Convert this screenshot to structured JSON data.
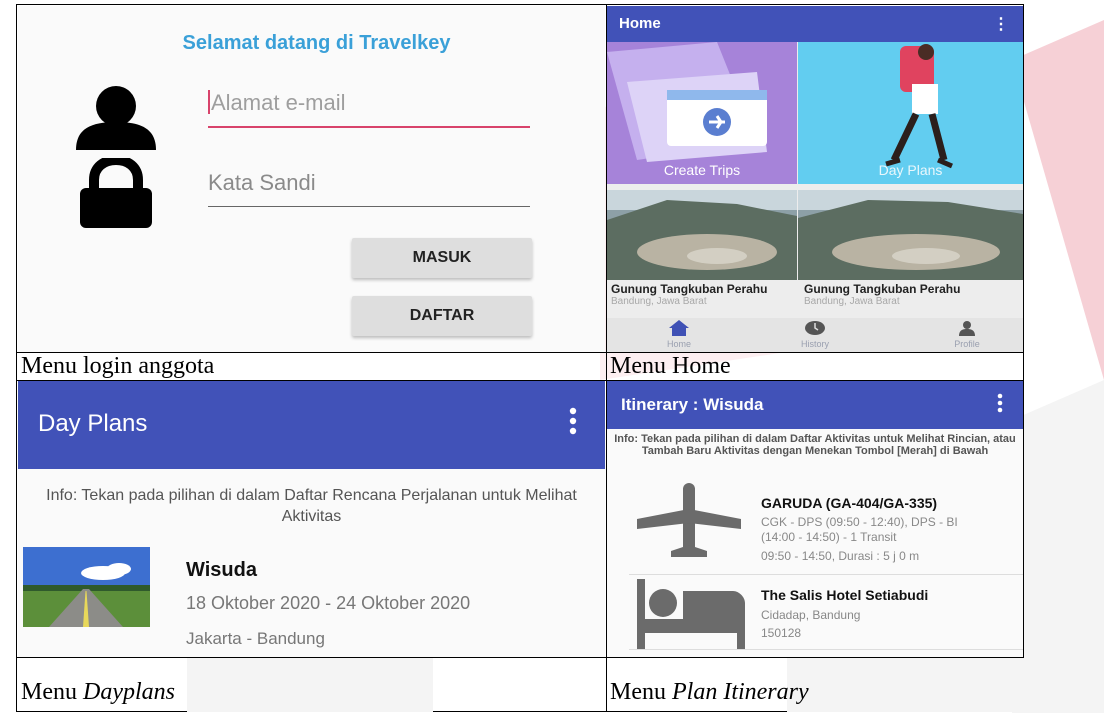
{
  "colors": {
    "app_bar": "#4152b8",
    "welcome_text": "#3aa0d8",
    "input_accent": "#d8436b",
    "button_bg": "#dedede",
    "background_shape": "#f6d7dc"
  },
  "login": {
    "title": "Selamat datang di Travelkey",
    "user_icon": "person-icon",
    "lock_icon": "lock-icon",
    "email_placeholder": "Alamat e-mail",
    "password_placeholder": "Kata Sandi",
    "masuk_label": "MASUK",
    "daftar_label": "DAFTAR",
    "caption": "Menu login anggota"
  },
  "home": {
    "title": "Home",
    "menu_icon": "more-vert-icon",
    "tiles": [
      {
        "label": "Create Trips",
        "icon": "travel-documents-illustration"
      },
      {
        "label": "Day Plans",
        "icon": "walking-traveler-illustration"
      }
    ],
    "cards": [
      {
        "title": "Gunung Tangkuban Perahu",
        "subtitle": "Bandung, Jawa Barat"
      },
      {
        "title": "Gunung Tangkuban Perahu",
        "subtitle": "Bandung, Jawa Barat"
      }
    ],
    "nav": [
      {
        "label": "Home",
        "icon": "home-icon"
      },
      {
        "label": "History",
        "icon": "history-icon"
      },
      {
        "label": "Profile",
        "icon": "person-icon"
      }
    ],
    "caption": "Menu Home"
  },
  "dayplans": {
    "title": "Day Plans",
    "info": "Info: Tekan pada pilihan di dalam Daftar Rencana Perjalanan untuk Melihat Aktivitas",
    "plan": {
      "name": "Wisuda",
      "dates": "18 Oktober 2020 - 24 Oktober 2020",
      "location": "Jakarta - Bandung"
    },
    "caption_prefix": "Menu ",
    "caption_italic": "Dayplans"
  },
  "itinerary": {
    "title": "Itinerary : Wisuda",
    "info": "Info: Tekan pada pilihan di dalam Daftar Aktivitas untuk Melihat Rincian, atau Tambah Baru Aktivitas dengan Menekan Tombol [Merah] di Bawah",
    "items": [
      {
        "icon": "airplane-icon",
        "title": "GARUDA (GA-404/GA-335)",
        "line1": "CGK - DPS (09:50 - 12:40), DPS - BI",
        "line2": "(14:00 - 14:50) - 1 Transit",
        "line3": "09:50 - 14:50, Durasi : 5 j 0 m"
      },
      {
        "icon": "hotel-bed-icon",
        "title": "The Salis Hotel Setiabudi",
        "line1": "Cidadap, Bandung",
        "line2": "150128"
      }
    ],
    "caption_prefix": "Menu ",
    "caption_italic": "Plan Itinerary"
  }
}
